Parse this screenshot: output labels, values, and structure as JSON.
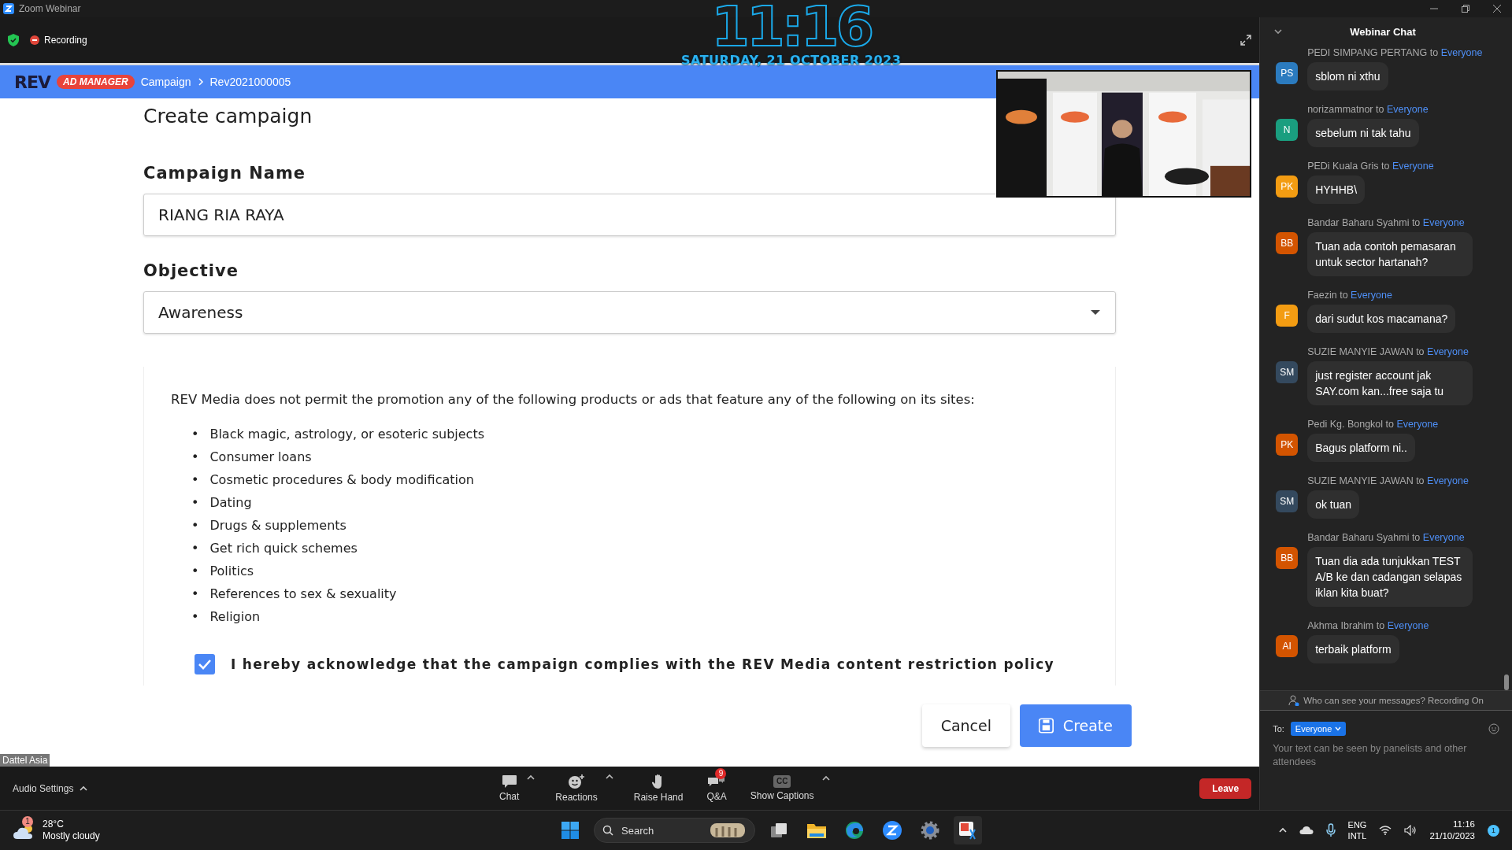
{
  "window": {
    "title": "Zoom Webinar"
  },
  "meeting_bar": {
    "recording": "Recording"
  },
  "clock_overlay": {
    "time": "11:16",
    "date": "SATURDAY, 21 OCTOBER 2023"
  },
  "shared_screen": {
    "logo": "REV",
    "badge": "AD MANAGER",
    "breadcrumb": [
      "Campaign",
      "Rev2021000005"
    ],
    "heading": "Create campaign",
    "fields": [
      {
        "kind": "text",
        "label": "Campaign Name",
        "value": "RIANG RIA RAYA"
      },
      {
        "kind": "select",
        "label": "Objective",
        "value": "Awareness"
      }
    ],
    "policy": {
      "marker": "•",
      "intro": "REV Media does not permit the promotion any of the following products or ads that feature any of the following on its sites:",
      "items": [
        "Black magic, astrology, or esoteric subjects",
        "Consumer loans",
        "Cosmetic procedures & body modification",
        "Dating",
        "Drugs & supplements",
        "Get rich quick schemes",
        "Politics",
        "References to sex & sexuality",
        "Religion"
      ]
    },
    "acknowledge": {
      "label": "I hereby acknowledge that the campaign complies with the REV Media content restriction policy",
      "checked": true
    },
    "buttons": [
      {
        "kind": "secondary",
        "label": "Cancel"
      },
      {
        "kind": "primary",
        "label": "Create"
      }
    ],
    "presenter_label": "Dattel Asia"
  },
  "chat": {
    "title": "Webinar Chat",
    "messages": [
      {
        "sender": "PEDI SIMPANG PERTANG to",
        "recipient": "Everyone",
        "initials": "PS",
        "color": "#2b7bbf",
        "text": "sblom ni xthu"
      },
      {
        "sender": "norizammatnor to",
        "recipient": "Everyone",
        "initials": "N",
        "color": "#1a9e7f",
        "text": "sebelum ni tak tahu"
      },
      {
        "sender": "PEDi Kuala Gris to",
        "recipient": "Everyone",
        "initials": "PK",
        "color": "#f39c12",
        "text": "HYHHB\\"
      },
      {
        "sender": "Bandar Baharu Syahmi to",
        "recipient": "Everyone",
        "initials": "BB",
        "color": "#d35400",
        "text": "Tuan ada contoh pemasaran untuk sector hartanah?"
      },
      {
        "sender": "Faezin to",
        "recipient": "Everyone",
        "initials": "F",
        "color": "#f39c12",
        "text": "dari sudut kos macamana?"
      },
      {
        "sender": "SUZIE MANYIE JAWAN to",
        "recipient": "Everyone",
        "initials": "SM",
        "color": "#34495e",
        "text": "just register account jak SAY.com kan...free saja tu"
      },
      {
        "sender": "Pedi Kg. Bongkol to",
        "recipient": "Everyone",
        "initials": "PK",
        "color": "#d35400",
        "text": "Bagus platform ni.."
      },
      {
        "sender": "SUZIE MANYIE JAWAN to",
        "recipient": "Everyone",
        "initials": "SM",
        "color": "#34495e",
        "text": "ok tuan"
      },
      {
        "sender": "Bandar Baharu Syahmi to",
        "recipient": "Everyone",
        "initials": "BB",
        "color": "#d35400",
        "text": "Tuan dia ada tunjukkan TEST A/B ke dan cadangan selapas iklan kita buat?"
      },
      {
        "sender": "Akhma Ibrahim to",
        "recipient": "Everyone",
        "initials": "AI",
        "color": "#d35400",
        "text": "terbaik platform"
      }
    ],
    "notice": "Who can see your messages? Recording On",
    "to_label": "To:",
    "recipient": "Everyone",
    "placeholder": "Your text can be seen by panelists and other attendees"
  },
  "toolbar": {
    "audio": "Audio Settings",
    "buttons": [
      {
        "kind": "chat",
        "label": "Chat",
        "caret": true
      },
      {
        "kind": "reactions",
        "label": "Reactions",
        "caret": true
      },
      {
        "kind": "hand",
        "label": "Raise Hand",
        "caret": false
      },
      {
        "kind": "qa",
        "label": "Q&A",
        "caret": false,
        "badge": "9"
      },
      {
        "kind": "captions",
        "label": "Show Captions",
        "caret": true,
        "icon_text": "CC"
      }
    ],
    "leave": "Leave"
  },
  "taskbar": {
    "weather": {
      "badge": "1",
      "temperature": "28°C",
      "condition": "Mostly cloudy"
    },
    "search": "Search",
    "language": [
      "ENG",
      "INTL"
    ],
    "time": "11:16",
    "date": "21/10/2023",
    "notifications": "1"
  }
}
